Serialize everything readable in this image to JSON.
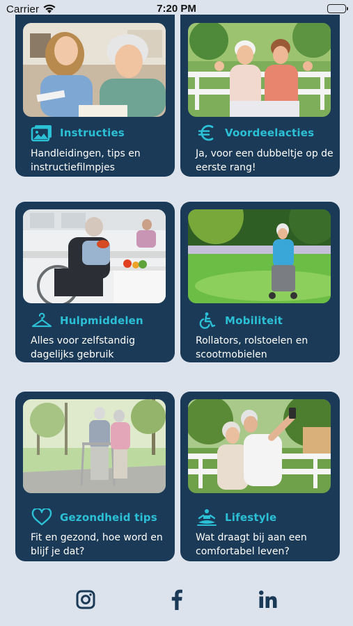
{
  "status_bar": {
    "carrier": "Carrier",
    "time": "7:20 PM"
  },
  "cards": [
    {
      "title": "Instructies",
      "description": "Handleidingen, tips en instructiefilmpjes",
      "icon": "image-gallery-icon",
      "image": "woman-helping-elderly-woman-photo"
    },
    {
      "title": "Voordeelacties",
      "description": "Ja, voor een dubbeltje op de eerste rang!",
      "icon": "euro-icon",
      "image": "elderly-women-thumbs-up-photo"
    },
    {
      "title": "Hulpmiddelen",
      "description": "Alles voor zelfstandig dagelijks gebruik",
      "icon": "hanger-icon",
      "image": "man-in-wheelchair-kitchen-photo"
    },
    {
      "title": "Mobiliteit",
      "description": "Rollators, rolstoelen en scootmobielen",
      "icon": "wheelchair-icon",
      "image": "woman-with-rollator-park-photo"
    },
    {
      "title": "Gezondheid tips",
      "description": "Fit en gezond, hoe word en blijf je dat?",
      "icon": "heart-icon",
      "image": "couple-walking-with-walker-photo"
    },
    {
      "title": "Lifestyle",
      "description": "Wat draagt bij aan een comfortabel leven?",
      "icon": "meditation-icon",
      "image": "couple-on-bench-selfie-photo"
    }
  ],
  "social": [
    {
      "name": "instagram-icon"
    },
    {
      "name": "facebook-icon"
    },
    {
      "name": "linkedin-icon"
    }
  ],
  "colors": {
    "background": "#dde3ec",
    "card": "#1b3a57",
    "accent": "#2cc0d6",
    "card_text": "#ffffff"
  }
}
